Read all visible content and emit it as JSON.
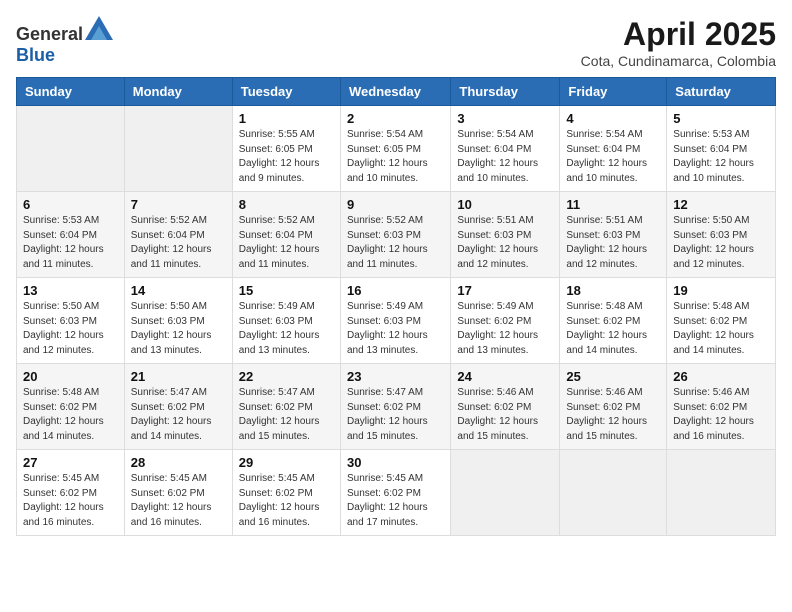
{
  "header": {
    "logo_general": "General",
    "logo_blue": "Blue",
    "month_year": "April 2025",
    "location": "Cota, Cundinamarca, Colombia"
  },
  "weekdays": [
    "Sunday",
    "Monday",
    "Tuesday",
    "Wednesday",
    "Thursday",
    "Friday",
    "Saturday"
  ],
  "weeks": [
    [
      {
        "day": "",
        "info": ""
      },
      {
        "day": "",
        "info": ""
      },
      {
        "day": "1",
        "info": "Sunrise: 5:55 AM\nSunset: 6:05 PM\nDaylight: 12 hours and 9 minutes."
      },
      {
        "day": "2",
        "info": "Sunrise: 5:54 AM\nSunset: 6:05 PM\nDaylight: 12 hours and 10 minutes."
      },
      {
        "day": "3",
        "info": "Sunrise: 5:54 AM\nSunset: 6:04 PM\nDaylight: 12 hours and 10 minutes."
      },
      {
        "day": "4",
        "info": "Sunrise: 5:54 AM\nSunset: 6:04 PM\nDaylight: 12 hours and 10 minutes."
      },
      {
        "day": "5",
        "info": "Sunrise: 5:53 AM\nSunset: 6:04 PM\nDaylight: 12 hours and 10 minutes."
      }
    ],
    [
      {
        "day": "6",
        "info": "Sunrise: 5:53 AM\nSunset: 6:04 PM\nDaylight: 12 hours and 11 minutes."
      },
      {
        "day": "7",
        "info": "Sunrise: 5:52 AM\nSunset: 6:04 PM\nDaylight: 12 hours and 11 minutes."
      },
      {
        "day": "8",
        "info": "Sunrise: 5:52 AM\nSunset: 6:04 PM\nDaylight: 12 hours and 11 minutes."
      },
      {
        "day": "9",
        "info": "Sunrise: 5:52 AM\nSunset: 6:03 PM\nDaylight: 12 hours and 11 minutes."
      },
      {
        "day": "10",
        "info": "Sunrise: 5:51 AM\nSunset: 6:03 PM\nDaylight: 12 hours and 12 minutes."
      },
      {
        "day": "11",
        "info": "Sunrise: 5:51 AM\nSunset: 6:03 PM\nDaylight: 12 hours and 12 minutes."
      },
      {
        "day": "12",
        "info": "Sunrise: 5:50 AM\nSunset: 6:03 PM\nDaylight: 12 hours and 12 minutes."
      }
    ],
    [
      {
        "day": "13",
        "info": "Sunrise: 5:50 AM\nSunset: 6:03 PM\nDaylight: 12 hours and 12 minutes."
      },
      {
        "day": "14",
        "info": "Sunrise: 5:50 AM\nSunset: 6:03 PM\nDaylight: 12 hours and 13 minutes."
      },
      {
        "day": "15",
        "info": "Sunrise: 5:49 AM\nSunset: 6:03 PM\nDaylight: 12 hours and 13 minutes."
      },
      {
        "day": "16",
        "info": "Sunrise: 5:49 AM\nSunset: 6:03 PM\nDaylight: 12 hours and 13 minutes."
      },
      {
        "day": "17",
        "info": "Sunrise: 5:49 AM\nSunset: 6:02 PM\nDaylight: 12 hours and 13 minutes."
      },
      {
        "day": "18",
        "info": "Sunrise: 5:48 AM\nSunset: 6:02 PM\nDaylight: 12 hours and 14 minutes."
      },
      {
        "day": "19",
        "info": "Sunrise: 5:48 AM\nSunset: 6:02 PM\nDaylight: 12 hours and 14 minutes."
      }
    ],
    [
      {
        "day": "20",
        "info": "Sunrise: 5:48 AM\nSunset: 6:02 PM\nDaylight: 12 hours and 14 minutes."
      },
      {
        "day": "21",
        "info": "Sunrise: 5:47 AM\nSunset: 6:02 PM\nDaylight: 12 hours and 14 minutes."
      },
      {
        "day": "22",
        "info": "Sunrise: 5:47 AM\nSunset: 6:02 PM\nDaylight: 12 hours and 15 minutes."
      },
      {
        "day": "23",
        "info": "Sunrise: 5:47 AM\nSunset: 6:02 PM\nDaylight: 12 hours and 15 minutes."
      },
      {
        "day": "24",
        "info": "Sunrise: 5:46 AM\nSunset: 6:02 PM\nDaylight: 12 hours and 15 minutes."
      },
      {
        "day": "25",
        "info": "Sunrise: 5:46 AM\nSunset: 6:02 PM\nDaylight: 12 hours and 15 minutes."
      },
      {
        "day": "26",
        "info": "Sunrise: 5:46 AM\nSunset: 6:02 PM\nDaylight: 12 hours and 16 minutes."
      }
    ],
    [
      {
        "day": "27",
        "info": "Sunrise: 5:45 AM\nSunset: 6:02 PM\nDaylight: 12 hours and 16 minutes."
      },
      {
        "day": "28",
        "info": "Sunrise: 5:45 AM\nSunset: 6:02 PM\nDaylight: 12 hours and 16 minutes."
      },
      {
        "day": "29",
        "info": "Sunrise: 5:45 AM\nSunset: 6:02 PM\nDaylight: 12 hours and 16 minutes."
      },
      {
        "day": "30",
        "info": "Sunrise: 5:45 AM\nSunset: 6:02 PM\nDaylight: 12 hours and 17 minutes."
      },
      {
        "day": "",
        "info": ""
      },
      {
        "day": "",
        "info": ""
      },
      {
        "day": "",
        "info": ""
      }
    ]
  ]
}
